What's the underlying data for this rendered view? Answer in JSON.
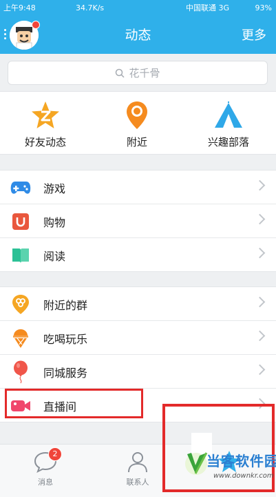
{
  "status_bar": {
    "time": "上午9:48",
    "net_speed": "34.7K/s",
    "carrier": "中国联通 3G",
    "battery": "93%"
  },
  "header": {
    "title": "动态",
    "more_label": "更多"
  },
  "search": {
    "placeholder": "花千骨"
  },
  "quick_entries": [
    {
      "label": "好友动态",
      "icon": "star-z-icon",
      "color": "#f5a623"
    },
    {
      "label": "附近",
      "icon": "location-pin-icon",
      "color": "#f58b1f"
    },
    {
      "label": "兴趣部落",
      "icon": "tent-icon",
      "color": "#2fa8e8"
    }
  ],
  "group1": [
    {
      "label": "游戏",
      "icon": "gamepad-icon",
      "color": "#2f8be6"
    },
    {
      "label": "购物",
      "icon": "shopping-bag-icon",
      "color": "#e9573d"
    },
    {
      "label": "阅读",
      "icon": "book-icon",
      "color": "#2cc196"
    }
  ],
  "group2": [
    {
      "label": "附近的群",
      "icon": "nearby-group-icon",
      "color": "#f5a623"
    },
    {
      "label": "吃喝玩乐",
      "icon": "ice-cream-icon",
      "color": "#f58b1f"
    },
    {
      "label": "同城服务",
      "icon": "balloon-icon",
      "color": "#f0564a"
    },
    {
      "label": "直播间",
      "icon": "video-camera-icon",
      "color": "#f0466c"
    }
  ],
  "tabs": [
    {
      "label": "消息",
      "icon": "message-icon",
      "badge": "2"
    },
    {
      "label": "联系人",
      "icon": "contacts-icon"
    },
    {
      "label": "",
      "icon": "star-icon"
    }
  ],
  "watermark": {
    "title": "当客软件园",
    "url": "www.downkr.com"
  },
  "colors": {
    "primary": "#2fb0ea",
    "highlight": "#e32a2a"
  }
}
